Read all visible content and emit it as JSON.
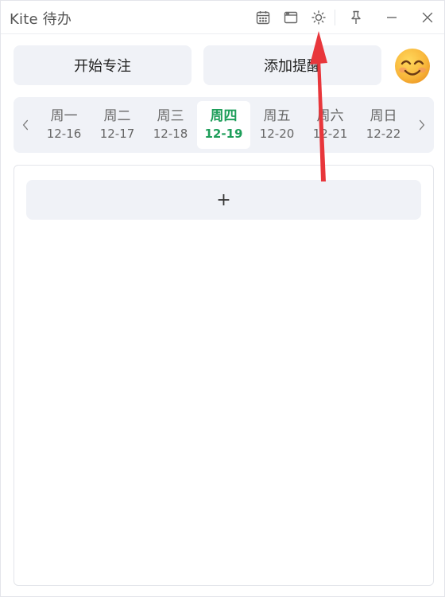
{
  "window": {
    "title": "Kite 待办"
  },
  "titlebar": {
    "icons": [
      "calendar-icon",
      "window-icon",
      "sun-icon",
      "pin-icon",
      "minimize-icon",
      "close-icon"
    ]
  },
  "actions": {
    "start_focus": "开始专注",
    "add_reminder": "添加提醒"
  },
  "week": {
    "days": [
      {
        "name": "周一",
        "date": "12-16",
        "active": false
      },
      {
        "name": "周二",
        "date": "12-17",
        "active": false
      },
      {
        "name": "周三",
        "date": "12-18",
        "active": false
      },
      {
        "name": "周四",
        "date": "12-19",
        "active": true
      },
      {
        "name": "周五",
        "date": "12-20",
        "active": false
      },
      {
        "name": "周六",
        "date": "12-21",
        "active": false
      },
      {
        "name": "周日",
        "date": "12-22",
        "active": false
      }
    ]
  },
  "main": {
    "add_label": "+"
  },
  "colors": {
    "accent": "#1e9e5a",
    "button_bg": "#f0f2f7",
    "annotation": "#e8363b"
  }
}
